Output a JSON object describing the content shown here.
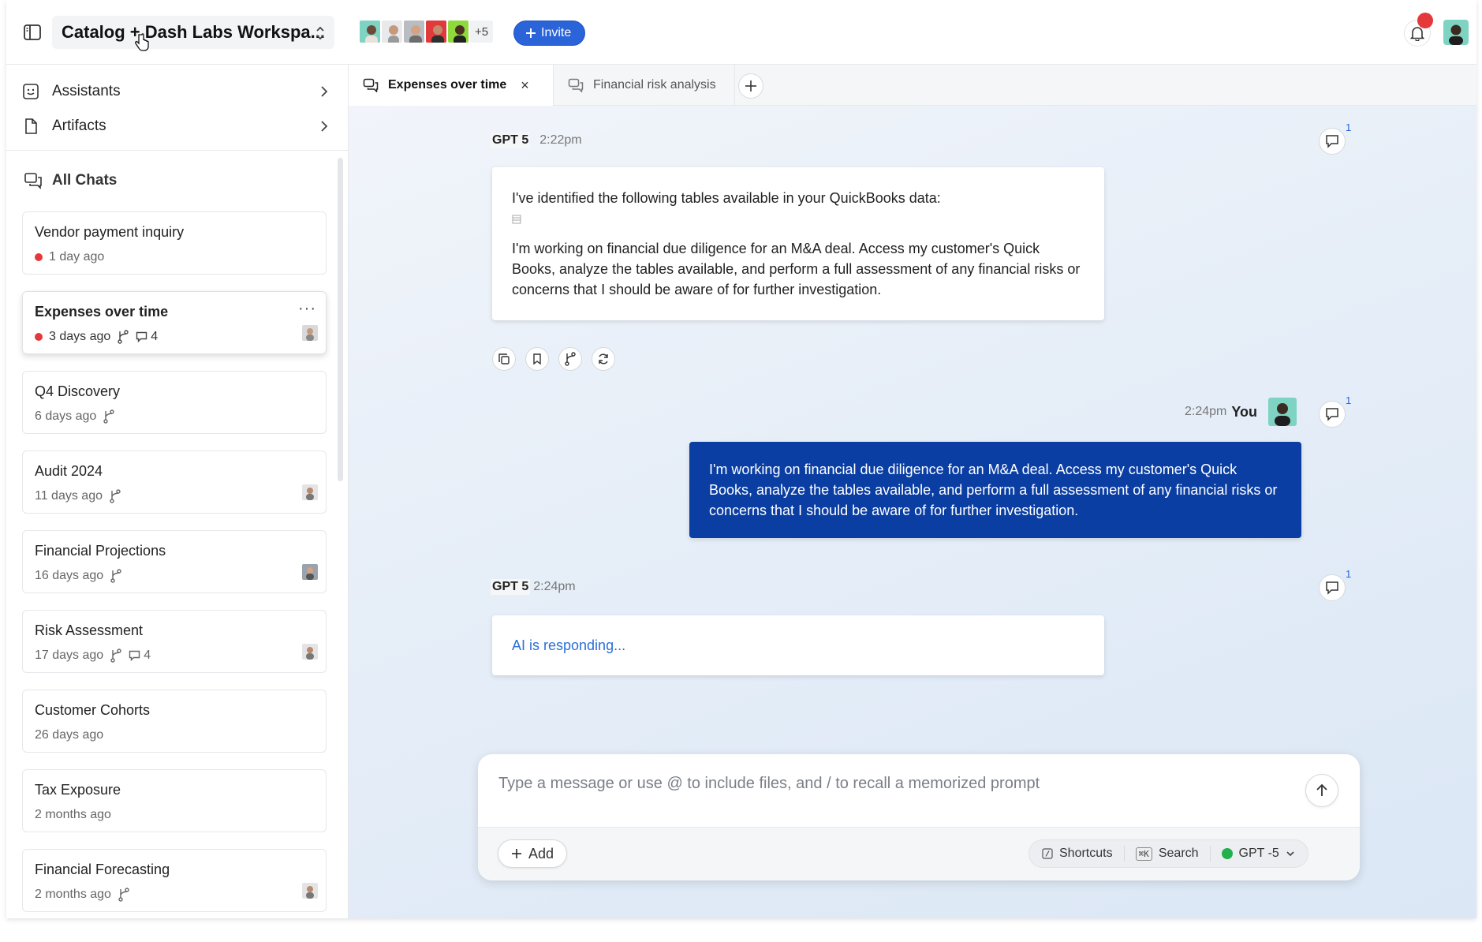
{
  "header": {
    "workspace_title": "Catalog + Dash Labs Workspa...",
    "more_members": "+5",
    "invite_label": "Invite"
  },
  "sidebar": {
    "nav": [
      {
        "label": "Assistants"
      },
      {
        "label": "Artifacts"
      }
    ],
    "all_chats_label": "All Chats",
    "chats": [
      {
        "title": "Vendor payment inquiry",
        "time": "1 day ago"
      },
      {
        "title": "Expenses over time",
        "time": "3 days ago",
        "comments": "4"
      },
      {
        "title": "Q4 Discovery",
        "time": "6 days ago"
      },
      {
        "title": "Audit 2024",
        "time": "11 days ago"
      },
      {
        "title": "Financial Projections",
        "time": "16 days ago"
      },
      {
        "title": "Risk Assessment",
        "time": "17 days ago",
        "comments": "4"
      },
      {
        "title": "Customer Cohorts",
        "time": "26 days ago"
      },
      {
        "title": "Tax Exposure",
        "time": "2 months ago"
      },
      {
        "title": "Financial Forecasting",
        "time": "2 months ago"
      }
    ]
  },
  "tabs": [
    {
      "label": "Expenses over time",
      "close": "×"
    },
    {
      "label": "Financial risk analysis"
    }
  ],
  "conversation": {
    "msg1": {
      "model": "GPT 5",
      "time": "2:22pm",
      "intro": "I've identified the following tables available in your QuickBooks data:",
      "body": "I'm working on financial due diligence for an M&A deal. Access my customer's Quick Books, analyze the tables available, and perform a full assessment of any financial risks or concerns that I should be aware of for further investigation.",
      "comment_count": "1"
    },
    "msg2": {
      "time": "2:24pm",
      "author": "You",
      "body": "I'm working on financial due diligence for an M&A deal. Access my customer's Quick Books, analyze the tables available, and perform a full assessment of any financial risks or concerns that I should be aware of for further investigation.",
      "comment_count": "1"
    },
    "msg3": {
      "model": "GPT 5",
      "time": "2:24pm",
      "status": "AI is responding...",
      "comment_count": "1"
    }
  },
  "composer": {
    "placeholder": "Type a message or use @ to include files, and / to recall a memorized prompt",
    "add_label": "Add",
    "shortcuts_label": "Shortcuts",
    "search_key": "⌘K",
    "search_label": "Search",
    "model_label": "GPT -5",
    "model_status_color": "#22b14c"
  },
  "colors": {
    "accent": "#2b63d9",
    "user_bubble": "#0a3ea3",
    "unread_dot": "#e5383b"
  }
}
